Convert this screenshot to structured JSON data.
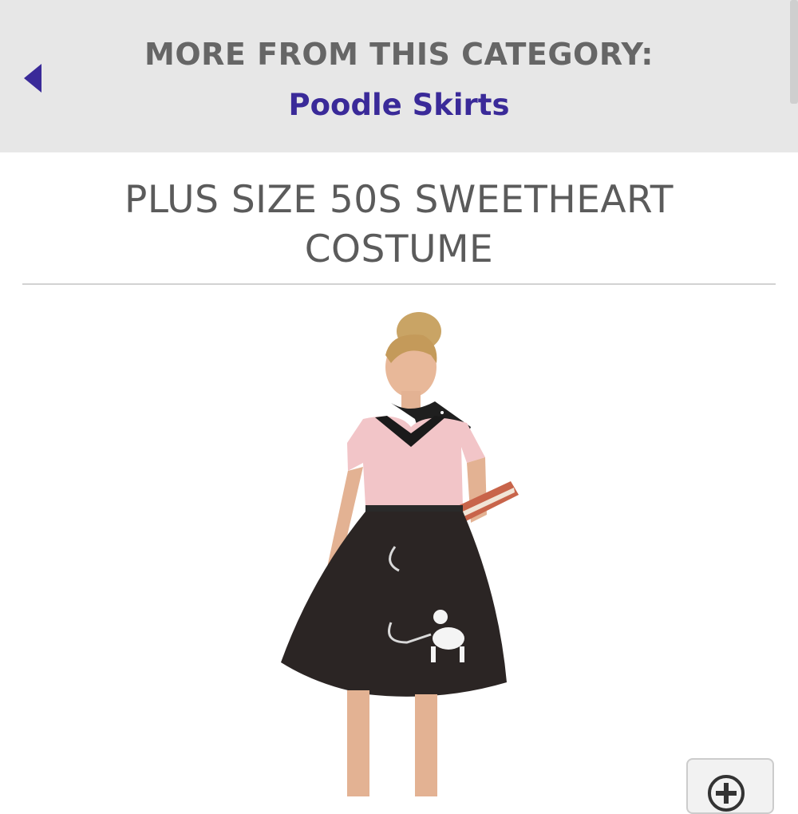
{
  "category_bar": {
    "heading": "MORE FROM THIS CATEGORY:",
    "link_label": "Poodle Skirts",
    "back_icon": "back-triangle-icon"
  },
  "product": {
    "title": "PLUS SIZE 50S SWEETHEART COSTUME",
    "image_description_icon": "product-photo"
  },
  "zoom": {
    "icon": "zoom-plus-icon"
  },
  "colors": {
    "link": "#3a2a99",
    "bar_bg": "#e7e7e7",
    "text_gray": "#666666"
  }
}
